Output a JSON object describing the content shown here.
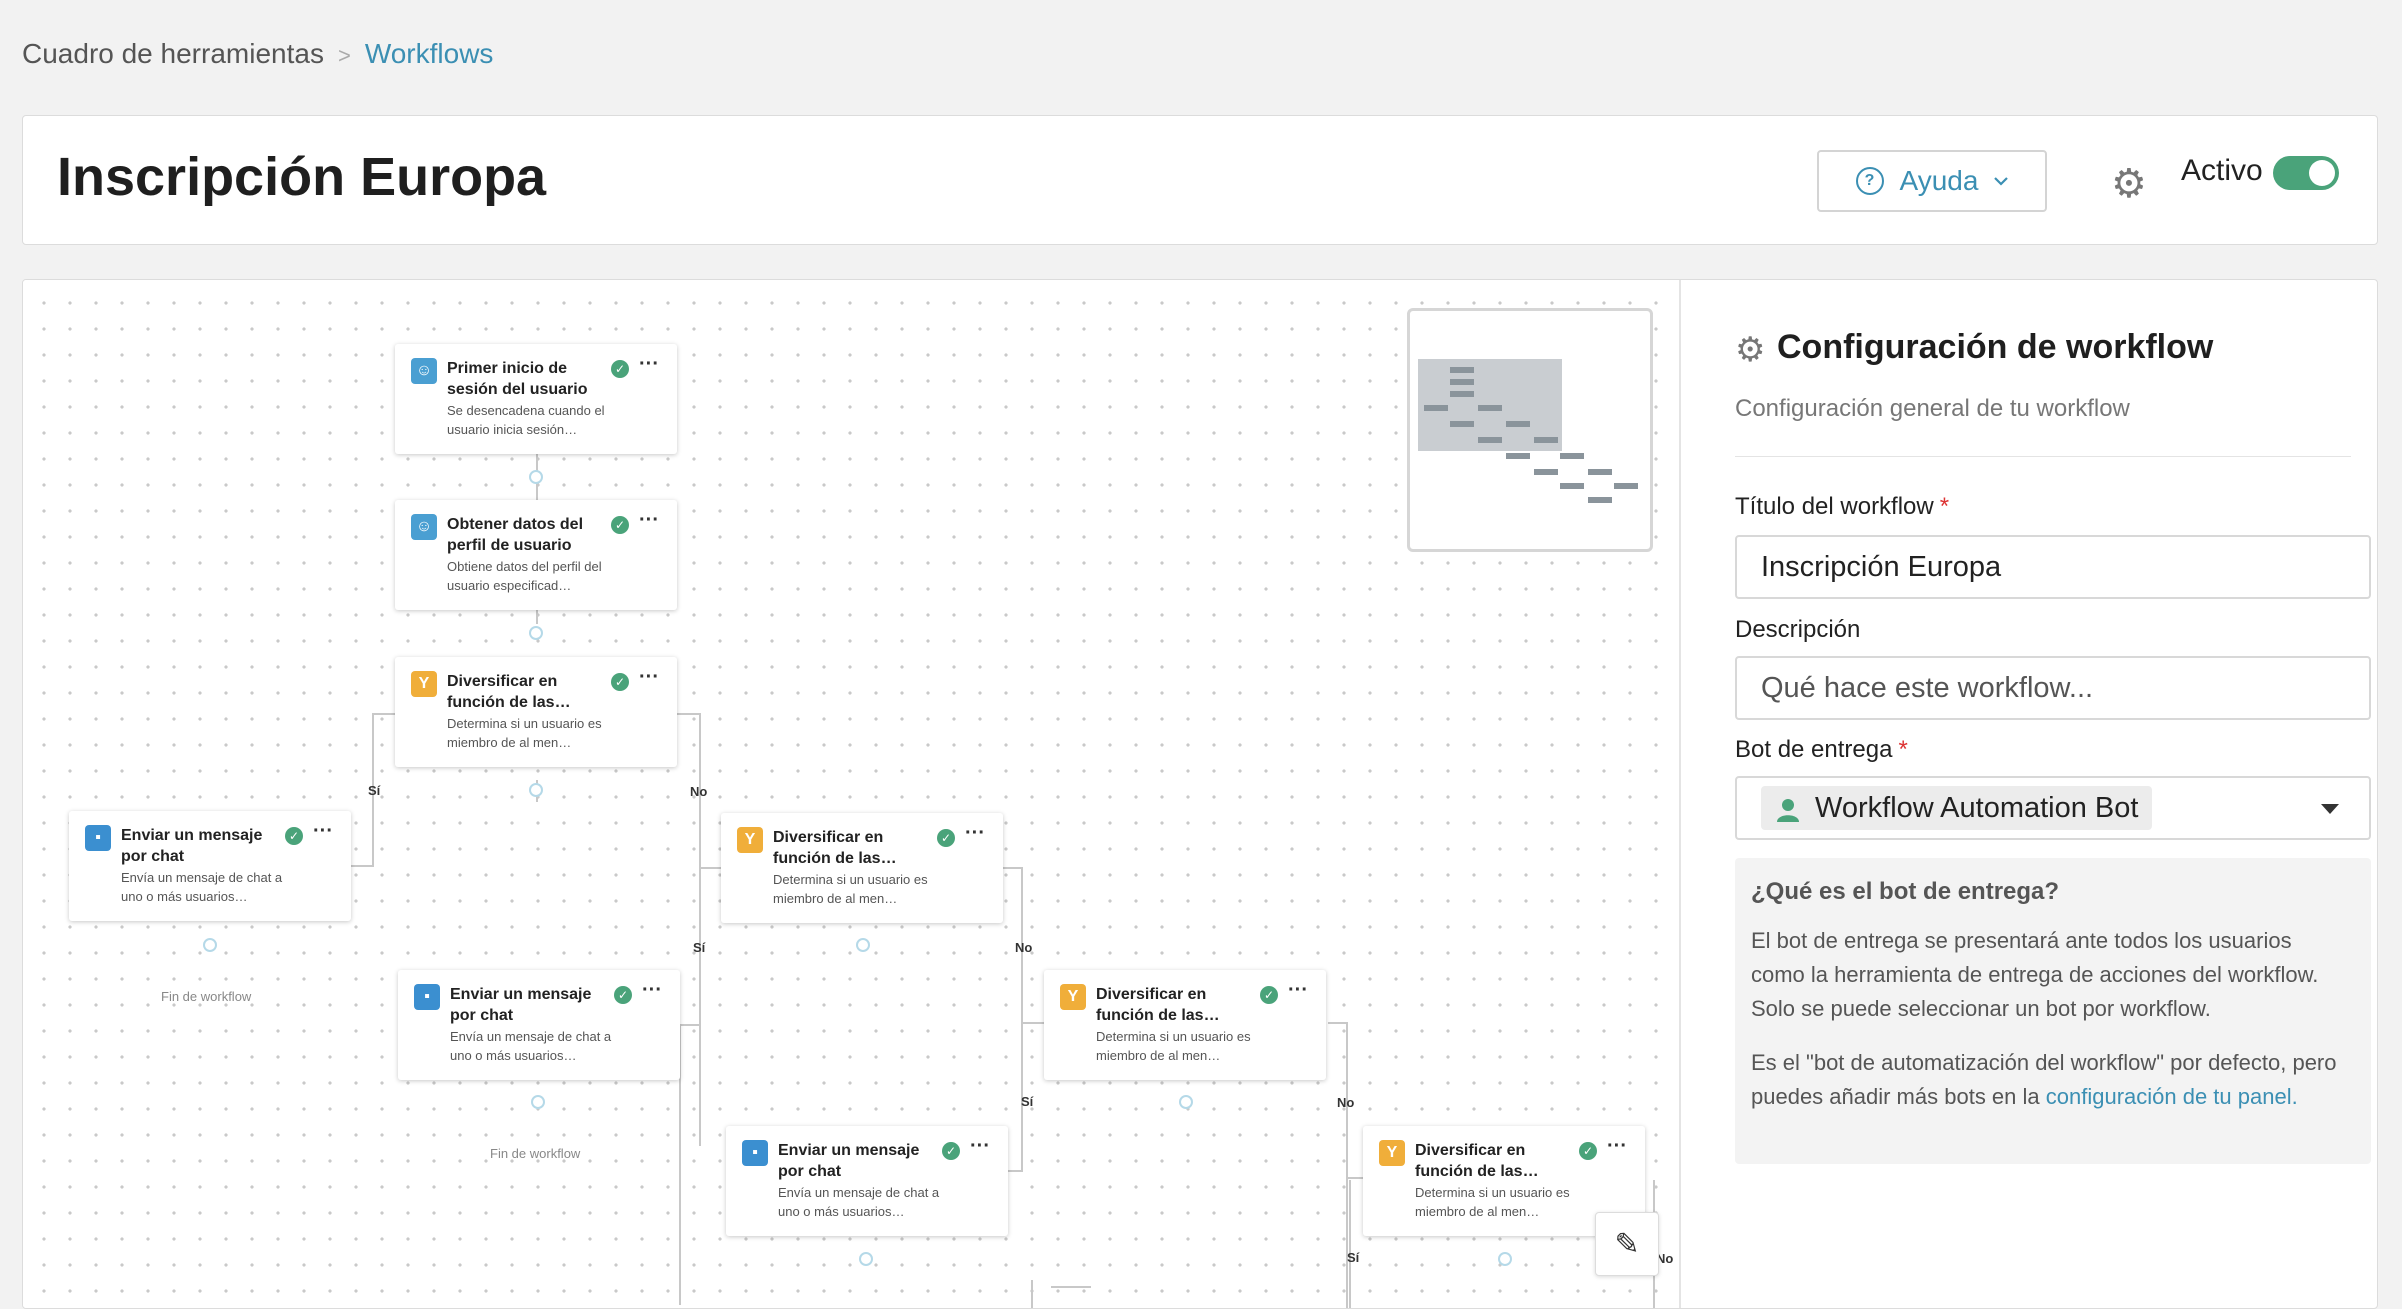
{
  "breadcrumb": {
    "root": "Cuadro de herramientas",
    "separator": ">",
    "current": "Workflows"
  },
  "header": {
    "title": "Inscripción Europa",
    "help_label": "Ayuda",
    "active_label": "Activo",
    "active_state": true
  },
  "canvas": {
    "nodes": [
      {
        "icon": "user-icon",
        "title": "Primer inicio de sesión del usuario",
        "desc": "Se desencadena cuando el usuario inicia sesión…"
      },
      {
        "icon": "user-icon",
        "title": "Obtener datos del perfil de usuario",
        "desc": "Obtiene datos del perfil del usuario especificad…"
      },
      {
        "icon": "branch-icon",
        "title": "Diversificar en función de las…",
        "desc": "Determina si un usuario es miembro de al men…"
      },
      {
        "icon": "chat-icon",
        "title": "Enviar un mensaje por chat",
        "desc": "Envía un mensaje de chat a uno o más usuarios…"
      },
      {
        "icon": "branch-icon",
        "title": "Diversificar en función de las…",
        "desc": "Determina si un usuario es miembro de al men…"
      },
      {
        "icon": "chat-icon",
        "title": "Enviar un mensaje por chat",
        "desc": "Envía un mensaje de chat a uno o más usuarios…"
      },
      {
        "icon": "branch-icon",
        "title": "Diversificar en función de las…",
        "desc": "Determina si un usuario es miembro de al men…"
      },
      {
        "icon": "chat-icon",
        "title": "Enviar un mensaje por chat",
        "desc": "Envía un mensaje de chat a uno o más usuarios…"
      },
      {
        "icon": "branch-icon",
        "title": "Diversificar en función de las…",
        "desc": "Determina si un usuario es miembro de al men…"
      }
    ],
    "branch_yes": "Sí",
    "branch_no": "No",
    "end_label": "Fin de workflow"
  },
  "panel": {
    "title": "Configuración de workflow",
    "subtitle": "Configuración general de tu workflow",
    "title_label": "Título del workflow",
    "title_value": "Inscripción Europa",
    "description_label": "Descripción",
    "description_placeholder": "Qué hace este workflow...",
    "bot_label": "Bot de entrega",
    "bot_value": "Workflow Automation Bot",
    "required_mark": "*",
    "info": {
      "title": "¿Qué es el bot de entrega?",
      "p1": "El bot de entrega se presentará ante todos los usuarios como la herramienta de entrega de acciones del workflow. Solo se puede seleccionar un bot por workflow.",
      "p2_prefix": "Es el \"bot de automatización del workflow\" por defecto, pero puedes añadir más bots en la ",
      "p2_link": "configuración de tu panel."
    }
  },
  "colors": {
    "accent": "#3b8fb3",
    "toggle_on": "#4aa37a",
    "branch": "#f0ae3a",
    "chat": "#3b8fd0"
  }
}
